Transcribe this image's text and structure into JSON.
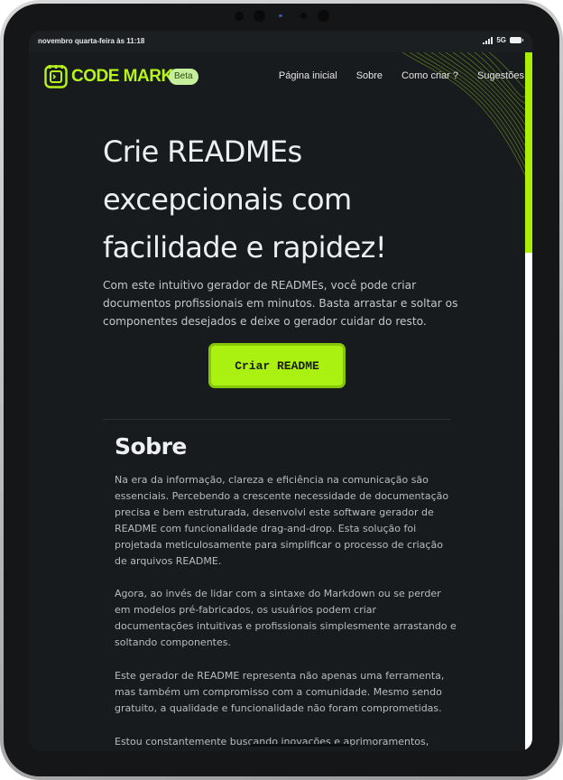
{
  "status_bar": {
    "time_text": "novembro quarta-feira às 11:18",
    "network": "5G",
    "icons": [
      "signal-icon",
      "battery-icon"
    ]
  },
  "nav": {
    "logo_text": "CODE MARK",
    "badge": "Beta",
    "links": [
      "Página inicial",
      "Sobre",
      "Como criar ?",
      "Sugestões"
    ]
  },
  "hero": {
    "title": "Crie READMEs excepcionais com facilidade e rapidez!",
    "description": "Com este intuitivo gerador de READMEs, você pode criar documentos profissionais em minutos. Basta arrastar e soltar os componentes desejados e deixe o gerador cuidar do resto.",
    "cta_label": "Criar README"
  },
  "about": {
    "title": "Sobre",
    "paragraphs": [
      "Na era da informação, clareza e eficiência na comunicação são essenciais. Percebendo a crescente necessidade de documentação precisa e bem estruturada, desenvolvi este software gerador de README com funcionalidade drag-and-drop. Esta solução foi projetada meticulosamente para simplificar o processo de criação de arquivos README.",
      "Agora, ao invés de lidar com a sintaxe do Markdown ou se perder em modelos pré-fabricados, os usuários podem criar documentações intuitivas e profissionais simplesmente arrastando e soltando componentes.",
      "Este gerador de README representa não apenas uma ferramenta, mas também um compromisso com a comunidade. Mesmo sendo gratuito, a qualidade e funcionalidade não foram comprometidas.",
      "Estou constantemente buscando inovações e aprimoramentos, sempre"
    ]
  },
  "colors": {
    "accent": "#aaf010",
    "page_background": "#181b1e",
    "badge_background": "#c5ef9a"
  }
}
